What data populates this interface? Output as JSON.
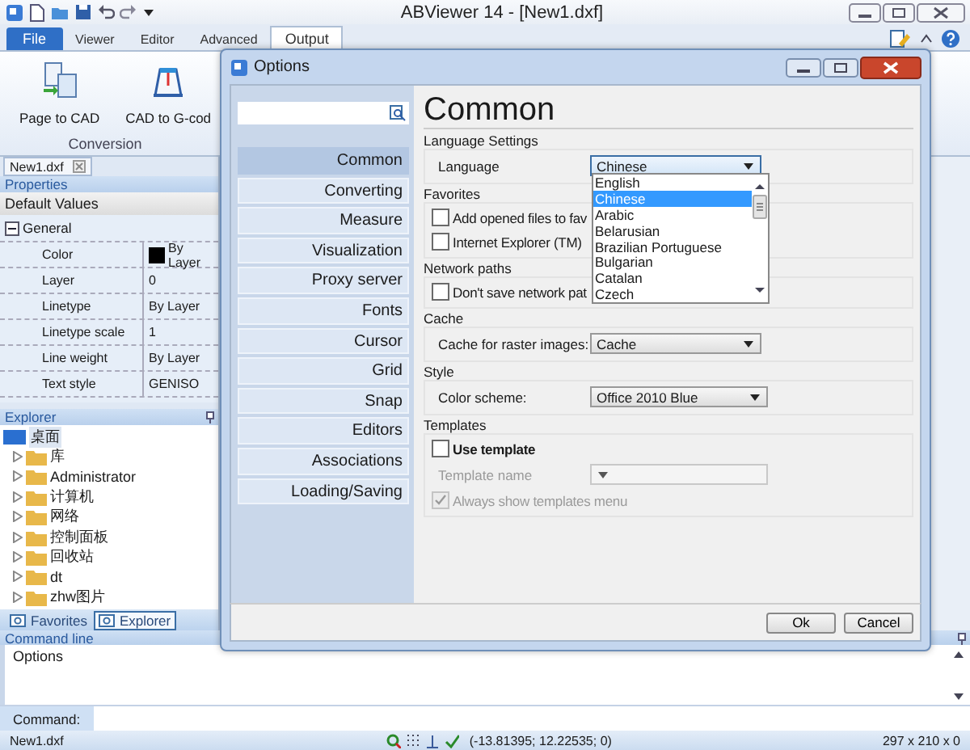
{
  "window": {
    "title": "ABViewer 14 - [New1.dxf]"
  },
  "ribbon": {
    "tabs": [
      {
        "label": "File",
        "kind": "file",
        "selected": false
      },
      {
        "label": "Viewer",
        "kind": "tab",
        "selected": false
      },
      {
        "label": "Editor",
        "kind": "tab",
        "selected": false
      },
      {
        "label": "Advanced",
        "kind": "tab",
        "selected": false
      },
      {
        "label": "Output",
        "kind": "tab",
        "selected": true
      }
    ],
    "buttons": [
      {
        "label": "Page to CAD",
        "kind": "page"
      },
      {
        "label": "CAD to G-cod",
        "kind": "gcode"
      }
    ],
    "group": "Conversion"
  },
  "document_tab": "New1.dxf",
  "properties": {
    "title": "Properties",
    "header": "Default Values",
    "group": {
      "label": "General",
      "expanded": true
    },
    "rows": [
      {
        "name": "Color",
        "value": "By Layer",
        "kind": "swatch"
      },
      {
        "name": "Layer",
        "value": "0",
        "kind": "text"
      },
      {
        "name": "Linetype",
        "value": "By Layer",
        "kind": "text"
      },
      {
        "name": "Linetype scale",
        "value": "1",
        "kind": "text"
      },
      {
        "name": "Line weight",
        "value": "By Layer",
        "kind": "text"
      },
      {
        "name": "Text style",
        "value": "GENISO",
        "kind": "text"
      }
    ]
  },
  "explorer": {
    "title": "Explorer",
    "tree": [
      {
        "label": "桌面",
        "children": [
          {
            "label": "库",
            "expanded": false
          },
          {
            "label": "Administrator",
            "expanded": false
          },
          {
            "label": "计算机",
            "expanded": false
          },
          {
            "label": "网络",
            "expanded": false
          },
          {
            "label": "控制面板",
            "expanded": false
          },
          {
            "label": "回收站",
            "expanded": false
          },
          {
            "label": "dt",
            "expanded": false
          },
          {
            "label": "zhw图片",
            "expanded": false
          }
        ]
      }
    ]
  },
  "panel_tabs": [
    {
      "label": "Favorites",
      "selected": false
    },
    {
      "label": "Explorer",
      "selected": true
    }
  ],
  "command_line": {
    "title": "Command line",
    "history": "Options",
    "prompt": "Command:"
  },
  "status_bar": {
    "file": "New1.dxf",
    "coordinates": "(-13.81395; 12.22535; 0)",
    "size": "297 x 210 x 0"
  },
  "options_dialog": {
    "title": "Options",
    "nav": [
      {
        "label": "Common",
        "selected": true
      },
      {
        "label": "Converting",
        "selected": false
      },
      {
        "label": "Measure",
        "selected": false
      },
      {
        "label": "Visualization",
        "selected": false
      },
      {
        "label": "Proxy server",
        "selected": false
      },
      {
        "label": "Fonts",
        "selected": false
      },
      {
        "label": "Cursor",
        "selected": false
      },
      {
        "label": "Grid",
        "selected": false
      },
      {
        "label": "Snap",
        "selected": false
      },
      {
        "label": "Editors",
        "selected": false
      },
      {
        "label": "Associations",
        "selected": false
      },
      {
        "label": "Loading/Saving",
        "selected": false
      }
    ],
    "heading": "Common",
    "sections": [
      {
        "title": "Language Settings",
        "items": [
          {
            "kind": "select",
            "label": "Language",
            "value": "Chinese",
            "disabled": false,
            "options": [
              {
                "label": "English",
                "selected": false
              },
              {
                "label": "Chinese",
                "selected": true
              },
              {
                "label": "Arabic",
                "selected": false
              },
              {
                "label": "Belarusian",
                "selected": false
              },
              {
                "label": "Brazilian Portuguese",
                "selected": false
              },
              {
                "label": "Bulgarian",
                "selected": false
              },
              {
                "label": "Catalan",
                "selected": false
              },
              {
                "label": "Czech",
                "selected": false
              }
            ]
          }
        ]
      },
      {
        "title": "Favorites",
        "items": [
          {
            "kind": "checkbox",
            "label": "Add opened files to fav",
            "checked": false,
            "disabled": false
          },
          {
            "kind": "checkbox",
            "label": "Internet Explorer (TM)",
            "checked": false,
            "disabled": false
          }
        ]
      },
      {
        "title": "Network paths",
        "items": [
          {
            "kind": "checkbox",
            "label": "Don't save network pat",
            "checked": false,
            "disabled": false
          }
        ]
      },
      {
        "title": "Cache",
        "items": [
          {
            "kind": "select",
            "label": "Cache for raster images:",
            "value": "Cache",
            "disabled": false
          }
        ]
      },
      {
        "title": "Style",
        "items": [
          {
            "kind": "select",
            "label": "Color scheme:",
            "value": "Office 2010 Blue",
            "disabled": false
          }
        ]
      },
      {
        "title": "Templates",
        "items": [
          {
            "kind": "checkbox",
            "label": "Use template",
            "checked": false,
            "disabled": false
          },
          {
            "kind": "select",
            "label": "Template name",
            "disabled": true
          },
          {
            "kind": "checkbox",
            "label": "Always show templates menu",
            "checked": true,
            "disabled": true
          }
        ]
      }
    ],
    "buttons": [
      "Ok",
      "Cancel"
    ]
  }
}
